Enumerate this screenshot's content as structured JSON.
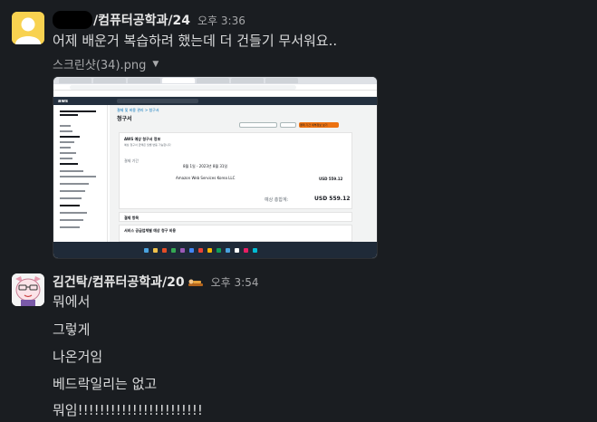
{
  "message1": {
    "name_suffix": "/컴퓨터공학과/24",
    "time": "오후 3:36",
    "text": "어제 배운거 복습하려 했는데 더 건들기 무서워요..",
    "file": {
      "name": "스크린샷(34).png",
      "dropdown_icon": "caret-down-icon",
      "preview": {
        "page_title": "청구서",
        "panel_title": "AWS 예상 청구서 정보",
        "company": "Amazon Web Services Korea LLC",
        "period": "8월 1일 - 2023년 8월 31일",
        "amount": "USD 559.12",
        "estimated_label": "예상 총합계:",
        "total": "USD 559.12",
        "primary_button": "결제 기간 세부정보 보기",
        "section2": "결제 항목",
        "section3": "서비스 공급업체별 예상 청구 비용"
      }
    }
  },
  "message2": {
    "name": "김건탁/컴퓨터공학과/20",
    "status_emoji": "person-lying-icon",
    "time": "오후 3:54",
    "lines": [
      "뭐에서",
      "그렇게",
      "나온거임",
      "베드락일리는 없고",
      "뭐임!!!!!!!!!!!!!!!!!!!!!!!"
    ]
  },
  "colors": {
    "background": "#1a1d21",
    "aws_orange": "#ec7211",
    "aws_navy": "#232f3e"
  }
}
